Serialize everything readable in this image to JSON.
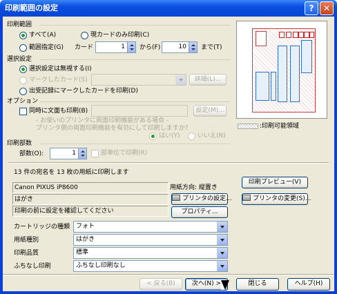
{
  "window": {
    "title": "印刷範囲の設定",
    "help_glyph": "?",
    "close_glyph": "✕"
  },
  "print_range": {
    "title": "印刷範囲",
    "all": "すべて(A)",
    "current_only": "現カードのみ印刷(C)",
    "range": "範囲指定(G)",
    "card_label": "カード",
    "from_value": "1",
    "from_label": "から(F)",
    "to_value": "10",
    "to_label": "まで(T)"
  },
  "selection": {
    "title": "選択設定",
    "ignore": "選択設定は無視する(I)",
    "marked": "マークしたカード(S)",
    "details_button": "詳細(L)...",
    "history": "出受記録にマークしたカードを印刷(D)"
  },
  "options": {
    "title": "オプション",
    "duplex_checkbox": "同時に文面も印刷(B)",
    "settings_button": "設定(M)...",
    "note_line1": "- お使いのプリンタに両面印刷機能がある場合 -",
    "note_line2": "プリンタ側の両面印刷機能を有効にして印刷しますか?",
    "yes": "はい(Y)",
    "no": "いいえ(N)"
  },
  "copies": {
    "title": "印刷部数",
    "label": "部数(O):",
    "value": "1",
    "collate": "部単位で印刷(R)"
  },
  "summary": "13 件の宛名を 13 枚の用紙に印刷します",
  "preview": {
    "legend": ":印刷可能領域"
  },
  "printer": {
    "name": "Canon PIXUS iP8600",
    "paper": "はがき",
    "confirm": "印刷の前に設定を確認してください",
    "orientation": "用紙方向: 縦置き",
    "printer_settings_button": "プリンタの設定...",
    "properties_button": "プロパティ...",
    "preview_button": "印刷プレビュー(V)",
    "change_printer_button": "プリンタの変更(S)..."
  },
  "settings_rows": [
    {
      "label": "カートリッジの種類",
      "value": "フォト"
    },
    {
      "label": "用紙種別",
      "value": "はがき"
    },
    {
      "label": "印刷品質",
      "value": "標準"
    },
    {
      "label": "ふちなし印刷",
      "value": "ふちなし印刷なし"
    }
  ],
  "footer": {
    "back": "< 戻る(B)",
    "next": "次へ(N) >",
    "close": "閉じる",
    "help": "ヘルプ(H)"
  },
  "colors": {
    "titlebar": "#0a4ee0",
    "dialog_bg": "#ece9d8",
    "radio_dot": "#21a121",
    "accent_border": "#003c74"
  }
}
